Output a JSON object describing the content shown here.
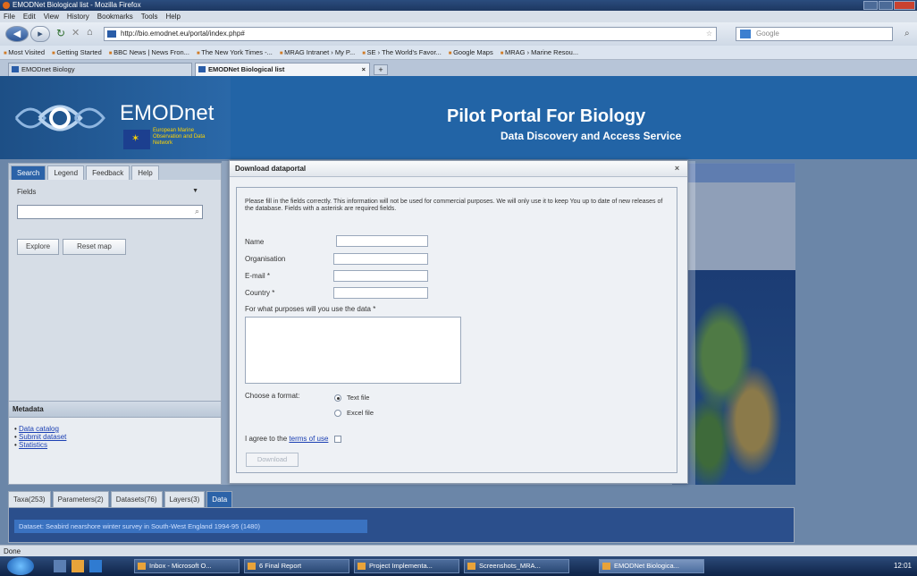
{
  "browser": {
    "window_title": "EMODNet Biological list - Mozilla Firefox",
    "menu": [
      "File",
      "Edit",
      "View",
      "History",
      "Bookmarks",
      "Tools",
      "Help"
    ],
    "url": "http://bio.emodnet.eu/portal/index.php#",
    "search_placeholder": "Google",
    "bookmarks": [
      "Most Visited",
      "Getting Started",
      "BBC News | News Fron...",
      "The New York Times -...",
      "MRAG Intranet › My P...",
      "SE › The World's Favor...",
      "Google Maps",
      "MRAG › Marine Resou..."
    ],
    "tabs": [
      {
        "label": "EMODnet Biology"
      },
      {
        "label": "EMODNet Biological list"
      }
    ],
    "status": "Done"
  },
  "header": {
    "logo_text": "EMODnet",
    "logo_sub": "European Marine Observation and Data Network",
    "title": "Pilot Portal For Biology",
    "subtitle": "Data Discovery and Access Service"
  },
  "left_panel": {
    "tabs": [
      "Search",
      "Legend",
      "Feedback",
      "Help"
    ],
    "dropdown_value": "Fields",
    "explore_label": "Explore",
    "reset_label": "Reset map",
    "metadata_title": "Metadata",
    "metadata_links": [
      "Data catalog",
      "Submit dataset",
      "Statistics"
    ]
  },
  "bottom": {
    "tabs": [
      "Taxa(253)",
      "Parameters(2)",
      "Datasets(76)",
      "Layers(3)",
      "Data"
    ],
    "dataset_text": "Dataset: Seabird nearshore winter survey in South-West England 1994-95 (1480)"
  },
  "dialog": {
    "title": "Download dataportal",
    "intro": "Please fill in the fields correctly. This information will not be used for commercial purposes. We will only use it to keep You up to date of new releases of the database. Fields with a asterisk are required fields.",
    "name_label": "Name",
    "org_label": "Organisation",
    "email_label": "E-mail *",
    "country_label": "Country *",
    "purpose_label": "For what purposes will you use the data *",
    "format_label": "Choose a format:",
    "format_options": [
      "Text file",
      "Excel file"
    ],
    "agree_prefix": "I agree to the",
    "terms_link": "terms of use",
    "download_label": "Download"
  },
  "taskbar": {
    "tasks": [
      "Inbox - Microsoft O...",
      "6 Final Report",
      "Project Implementa...",
      "Screenshots_MRA...",
      "EMODNet Biologica..."
    ],
    "clock": "12:01"
  }
}
